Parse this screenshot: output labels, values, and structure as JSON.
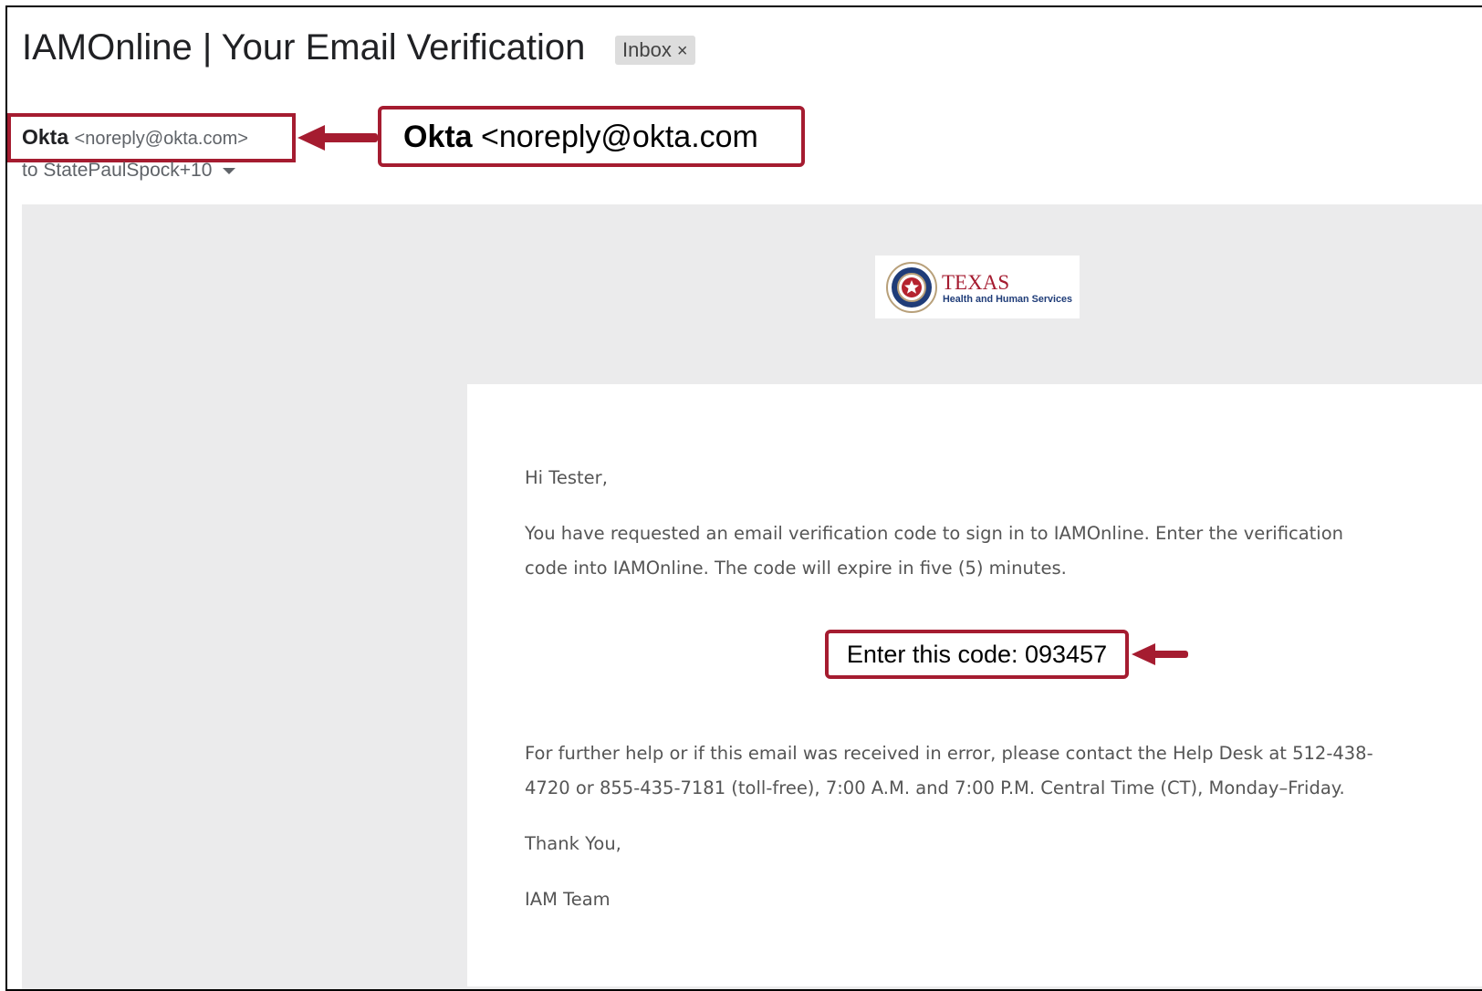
{
  "email": {
    "subject": "IAMOnline | Your Email Verification",
    "label_chip": "Inbox",
    "label_chip_close": "×",
    "sender_name": "Okta",
    "sender_email": "<noreply@okta.com>",
    "recipients": "to StatePaulSpock+10"
  },
  "callouts": {
    "sender_name": "Okta",
    "sender_email": "<noreply@okta.com"
  },
  "logo": {
    "title": "TEXAS",
    "subtitle": "Health and Human Services"
  },
  "message": {
    "greeting": "Hi Tester,",
    "para1_line1": "You have requested an email verification code to sign in to IAMOnline. Enter the verification",
    "para1_line2": "code into IAMOnline. The code will expire in five (5) minutes.",
    "code_text": "Enter this code: 093457",
    "para2_line1": "For further help or if this email was received in error, please contact the Help Desk at 512-438-",
    "para2_line2": "4720 or 855-435-7181 (toll-free), 7:00 A.M. and 7:00 P.M. Central Time (CT), Monday–Friday.",
    "closing": "Thank You,",
    "signature": "IAM Team"
  },
  "colors": {
    "annotation_red": "#a51c30",
    "email_background": "#ebebec"
  }
}
